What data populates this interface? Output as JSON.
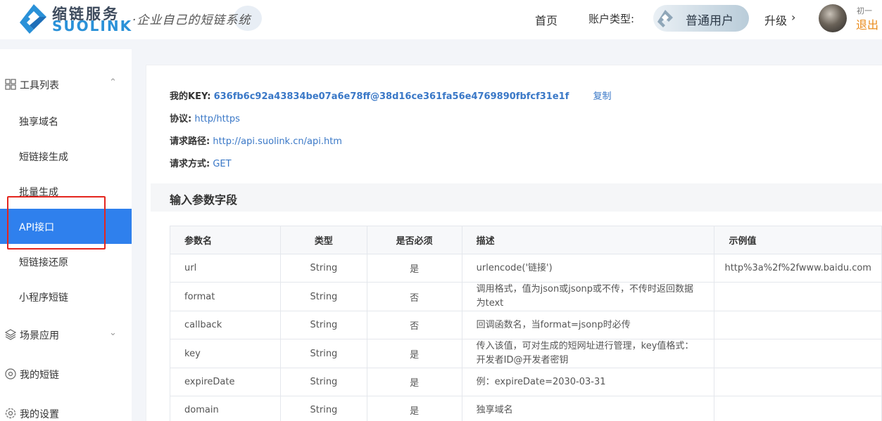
{
  "header": {
    "brand_cn": "缩链服务",
    "brand_en": "SUOLINK",
    "tagline": "·企业自己的短链系统",
    "nav_home": "首页",
    "account_type_label": "账户类型:",
    "account_type_value": "普通用户",
    "upgrade": "升级",
    "username": "初一",
    "logout": "退出"
  },
  "sidebar": {
    "tools_section": "工具列表",
    "items": [
      {
        "label": "独享域名"
      },
      {
        "label": "短链接生成"
      },
      {
        "label": "批量生成"
      },
      {
        "label": "API接口",
        "active": true
      },
      {
        "label": "短链接还原"
      },
      {
        "label": "小程序短链"
      }
    ],
    "scene_section": "场景应用",
    "my_links": "我的短链",
    "my_settings": "我的设置"
  },
  "api_info": {
    "key_label": "我的KEY:",
    "key_value": "636fb6c92a43834be07a6e78ff@38d16ce361fa56e4769890fbfcf31e1f",
    "copy": "复制",
    "protocol_label": "协议:",
    "protocol_value": "http/https",
    "path_label": "请求路径:",
    "path_value": "http://api.suolink.cn/api.htm",
    "method_label": "请求方式:",
    "method_value": "GET"
  },
  "params_section_title": "输入参数字段",
  "params_table": {
    "headers": [
      "参数名",
      "类型",
      "是否必须",
      "描述",
      "示例值"
    ],
    "rows": [
      {
        "name": "url",
        "type": "String",
        "required": "是",
        "desc": "urlencode('链接')",
        "example": "http%3a%2f%2fwww.baidu.com"
      },
      {
        "name": "format",
        "type": "String",
        "required": "否",
        "desc": "调用格式，值为json或jsonp或不传，不传时返回数据为text",
        "example": ""
      },
      {
        "name": "callback",
        "type": "String",
        "required": "否",
        "desc": "回调函数名，当format=jsonp时必传",
        "example": ""
      },
      {
        "name": "key",
        "type": "String",
        "required": "是",
        "desc": "传入该值，可对生成的短网址进行管理，key值格式：开发者ID@开发者密钥",
        "example": ""
      },
      {
        "name": "expireDate",
        "type": "String",
        "required": "是",
        "desc": "例：expireDate=2030-03-31",
        "example": ""
      },
      {
        "name": "domain",
        "type": "String",
        "required": "是",
        "desc": "独享域名",
        "example": ""
      }
    ]
  },
  "colors": {
    "accent": "#2f80ed",
    "link": "#3a78c7",
    "logout": "#e98a1a",
    "highlight": "#e4261e"
  }
}
